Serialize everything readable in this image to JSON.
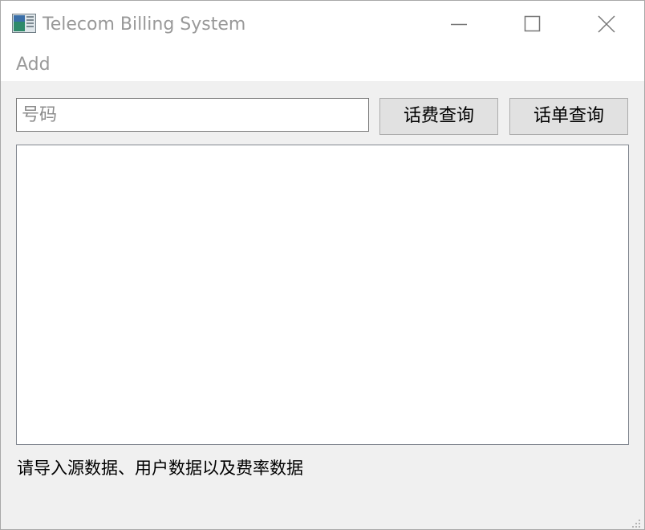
{
  "window": {
    "title": "Telecom Billing System",
    "icon": "app-icon"
  },
  "titlebar_controls": {
    "minimize_icon": "minimize-icon",
    "maximize_icon": "maximize-icon",
    "close_icon": "close-icon"
  },
  "menubar": {
    "items": [
      {
        "label": "Add"
      }
    ]
  },
  "search": {
    "value": "",
    "placeholder": "号码"
  },
  "buttons": {
    "fee_query": "话费查询",
    "bill_query": "话单查询"
  },
  "results": {
    "content": ""
  },
  "status": {
    "message": "请导入源数据、用户数据以及费率数据"
  },
  "colors": {
    "window_bg": "#f0f0f0",
    "titlebar_bg": "#ffffff",
    "button_bg": "#e1e1e1",
    "disabled_text": "#999999"
  }
}
